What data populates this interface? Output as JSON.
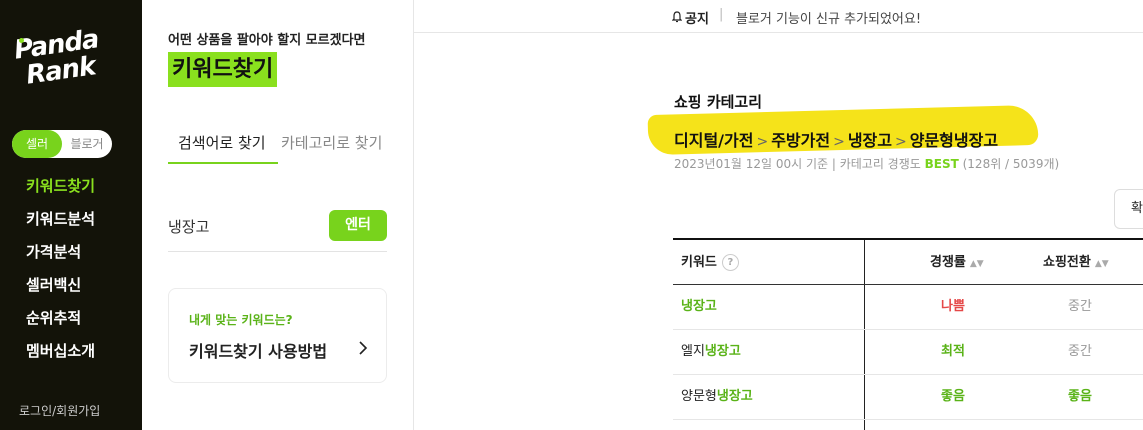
{
  "sidebar": {
    "logo_line1": "Panda",
    "logo_line2": "Rank",
    "toggle": {
      "seller": "셀러",
      "blogger": "블로거"
    },
    "nav": [
      "키워드찾기",
      "키워드분석",
      "가격분석",
      "셀러백신",
      "순위추적",
      "멤버십소개"
    ],
    "login": "로그인/회원가입"
  },
  "panel": {
    "subtitle": "어떤 상품을 팔아야 할지 모르겠다면",
    "title": "키워드찾기",
    "tab_search": "검색어로 찾기",
    "tab_category": "카테고리로 찾기",
    "query": "냉장고",
    "enter": "엔터",
    "howto_small": "내게 맞는 키워드는?",
    "howto_title": "키워드찾기 사용방법"
  },
  "notice": {
    "label": "공지",
    "text": "블로거 기능이 신규 추가되었어요!"
  },
  "category": {
    "title": "쇼핑 카테고리",
    "crumbs": [
      "디지털/가전",
      "주방가전",
      "냉장고",
      "양문형냉장고"
    ],
    "separator": ">",
    "meta_prefix": "2023년01월 12일 00시 기준  |  카테고리 경쟁도 ",
    "meta_best": "BEST",
    "meta_suffix": " (128위 / 5039개)"
  },
  "sort_button": "확",
  "table": {
    "headers": {
      "keyword": "키워드",
      "help": "?",
      "competition": "경쟁률",
      "conversion": "쇼핑전환",
      "sort_icon": "▲▼"
    },
    "rows": [
      {
        "prefix": "",
        "highlight": "냉장고",
        "competition": "나쁨",
        "conversion": "중간"
      },
      {
        "prefix": "엘지",
        "highlight": "냉장고",
        "competition": "최적",
        "conversion": "중간"
      },
      {
        "prefix": "양문형",
        "highlight": "냉장고",
        "competition": "좋음",
        "conversion": "좋음"
      }
    ]
  },
  "colors": {
    "accent": "#78d31c",
    "sidebar_bg": "#131309",
    "highlight": "#f5e31a",
    "bad": "#e54848"
  }
}
